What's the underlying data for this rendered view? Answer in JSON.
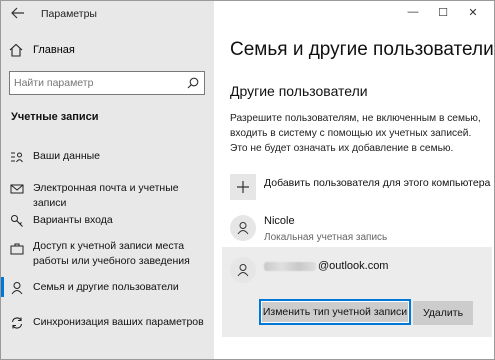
{
  "window": {
    "app_title": "Параметры",
    "controls": {
      "minimize": "—",
      "maximize": "☐",
      "close": "✕"
    }
  },
  "sidebar": {
    "home_label": "Главная",
    "search_placeholder": "Найти параметр",
    "section_title": "Учетные записи",
    "items": [
      {
        "label": "Ваши данные",
        "icon": "contact-card-icon"
      },
      {
        "label": "Электронная почта и учетные записи",
        "icon": "mail-icon"
      },
      {
        "label": "Варианты входа",
        "icon": "key-icon"
      },
      {
        "label": "Доступ к учетной записи места работы или учебного заведения",
        "icon": "briefcase-icon"
      },
      {
        "label": "Семья и другие пользователи",
        "icon": "person-icon",
        "selected": true
      },
      {
        "label": "Синхронизация ваших параметров",
        "icon": "sync-icon"
      }
    ]
  },
  "main": {
    "title": "Семья и другие пользователи",
    "section_title": "Другие пользователи",
    "description": "Разрешите пользователям, не включенным в семью, входить в систему с помощью их учетных записей. Это не будет означать их добавление в семью.",
    "add_user_label": "Добавить пользователя для этого компьютера",
    "users": [
      {
        "name": "Nicole",
        "subtitle": "Локальная учетная запись"
      },
      {
        "name": "@outlook.com"
      }
    ],
    "change_account_type_label": "Изменить тип учетной записи",
    "delete_label": "Удалить"
  },
  "colors": {
    "accent": "#0078d7",
    "sidebar_bg": "#e8e8e8",
    "button_bg": "#cccccc"
  }
}
